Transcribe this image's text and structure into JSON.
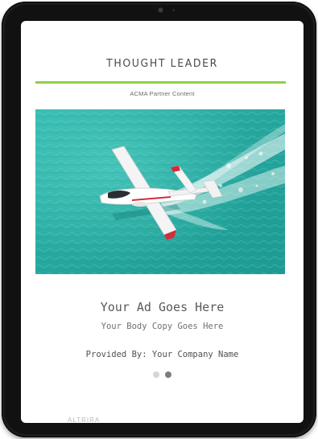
{
  "ad": {
    "brand_title": "THOUGHT LEADER",
    "partner_label": "ACMA Partner Content",
    "headline": "Your Ad Goes Here",
    "body_copy": "Your Body Copy Goes Here",
    "provided_by": "Provided By: Your Company Name",
    "next_label_peek": "ALTRIRA"
  },
  "carousel": {
    "slide_count": 2,
    "active_index": 1
  },
  "colors": {
    "accent_rule": "#8ed04a",
    "water": "#2fb2a7",
    "device_frame": "#1c1c1e"
  },
  "icons": {
    "hero_image": "seaplane-over-water"
  }
}
